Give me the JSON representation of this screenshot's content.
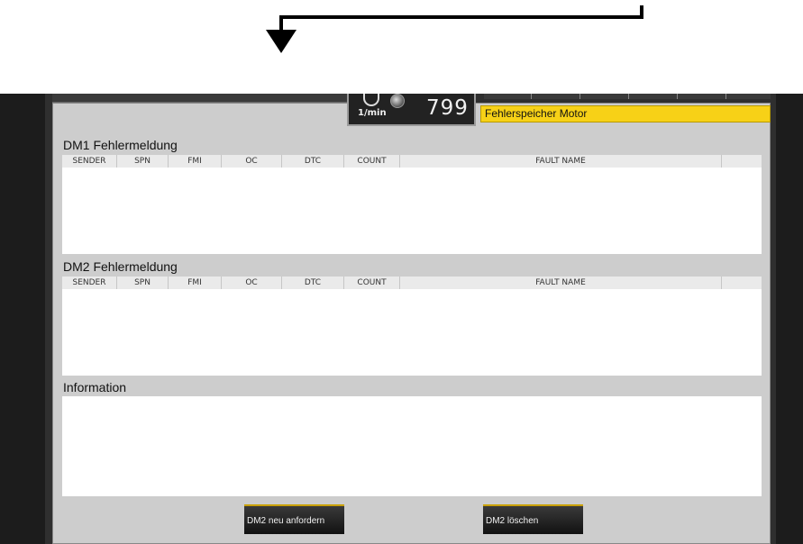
{
  "header": {
    "rpm_unit": "1/min",
    "rpm_value": "799",
    "title": "Fehlerspeicher Motor"
  },
  "dm1": {
    "label": "DM1 Fehlermeldung",
    "columns": [
      "SENDER",
      "SPN",
      "FMI",
      "OC",
      "DTC",
      "COUNT",
      "FAULT NAME"
    ]
  },
  "dm2": {
    "label": "DM2 Fehlermeldung",
    "columns": [
      "SENDER",
      "SPN",
      "FMI",
      "OC",
      "DTC",
      "COUNT",
      "FAULT NAME"
    ]
  },
  "information": {
    "label": "Information"
  },
  "buttons": {
    "request_dm2": "DM2 neu anfordern",
    "clear_dm2": "DM2 löschen"
  },
  "colors": {
    "banner": "#f7d117",
    "panel": "#cdcdcd",
    "button_accent": "#c9a000"
  }
}
